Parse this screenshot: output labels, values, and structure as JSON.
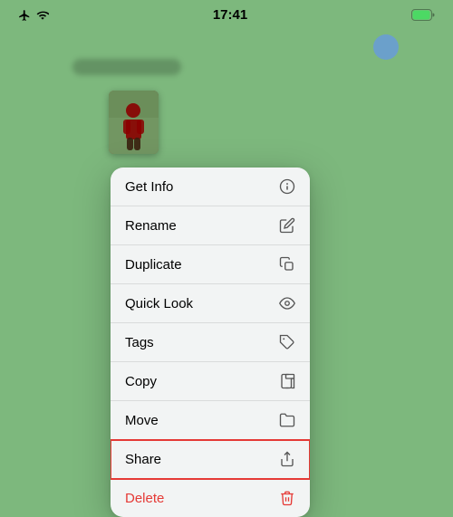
{
  "statusBar": {
    "time": "17:41",
    "batteryIcon": "battery-icon"
  },
  "menu": {
    "items": [
      {
        "id": "get-info",
        "label": "Get Info",
        "icon": "info-circle-icon"
      },
      {
        "id": "rename",
        "label": "Rename",
        "icon": "pencil-icon"
      },
      {
        "id": "duplicate",
        "label": "Duplicate",
        "icon": "duplicate-icon"
      },
      {
        "id": "quick-look",
        "label": "Quick Look",
        "icon": "eye-icon"
      },
      {
        "id": "tags",
        "label": "Tags",
        "icon": "tag-icon"
      },
      {
        "id": "copy",
        "label": "Copy",
        "icon": "copy-icon"
      },
      {
        "id": "move",
        "label": "Move",
        "icon": "folder-icon"
      },
      {
        "id": "share",
        "label": "Share",
        "icon": "share-icon",
        "highlighted": true
      },
      {
        "id": "delete",
        "label": "Delete",
        "icon": "trash-icon",
        "destructive": true
      }
    ]
  }
}
